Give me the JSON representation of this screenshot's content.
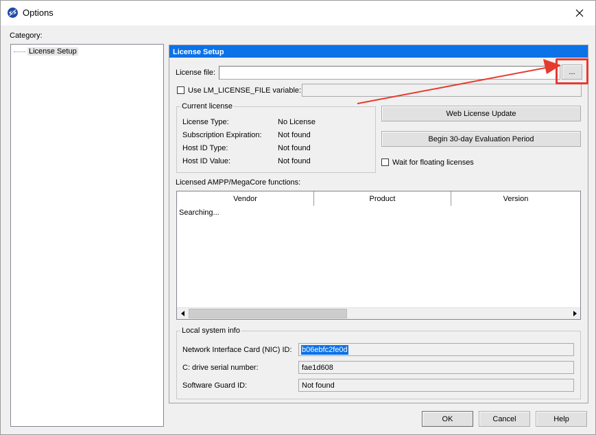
{
  "window": {
    "title": "Options",
    "close_symbol": "✕"
  },
  "category": {
    "label": "Category:",
    "items": [
      {
        "label": "License Setup"
      }
    ]
  },
  "license_setup": {
    "header": "License Setup",
    "license_file_label": "License file:",
    "license_file_value": "",
    "browse_label": "...",
    "use_lm_license_label": "Use LM_LICENSE_FILE variable:",
    "lm_license_value": "",
    "current_license": {
      "legend": "Current license",
      "rows": [
        {
          "label": "License Type:",
          "value": "No License"
        },
        {
          "label": "Subscription Expiration:",
          "value": "Not found"
        },
        {
          "label": "Host ID Type:",
          "value": "Not found"
        },
        {
          "label": "Host ID Value:",
          "value": "Not found"
        }
      ]
    },
    "web_license_update_label": "Web License Update",
    "begin_eval_label": "Begin 30-day Evaluation Period",
    "wait_floating_label": "Wait for floating licenses",
    "ampp_label": "Licensed AMPP/MegaCore functions:",
    "table": {
      "columns": [
        "Vendor",
        "Product",
        "Version"
      ],
      "status": "Searching..."
    },
    "local_system": {
      "legend": "Local system info",
      "rows": [
        {
          "label": "Network Interface Card (NIC) ID:",
          "value": "b06ebfc2fe0d"
        },
        {
          "label": "C: drive serial number:",
          "value": "fae1d608"
        },
        {
          "label": "Software Guard ID:",
          "value": "Not found"
        }
      ]
    }
  },
  "footer": {
    "ok": "OK",
    "cancel": "Cancel",
    "help": "Help"
  },
  "colors": {
    "accent": "#0b72e7",
    "annotation": "#e63a2e"
  }
}
